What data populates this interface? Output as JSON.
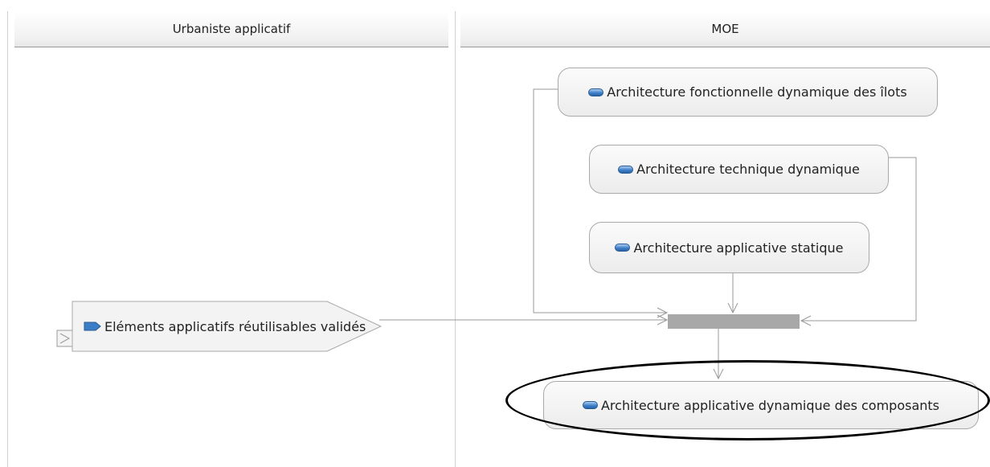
{
  "lanes": [
    {
      "label": "Urbaniste applicatif"
    },
    {
      "label": "MOE"
    }
  ],
  "nodes": {
    "func_dyn": {
      "label": "Architecture fonctionnelle dynamique des îlots",
      "icon": "activity-pill-icon"
    },
    "tech_dyn": {
      "label": "Architecture technique dynamique",
      "icon": "activity-pill-icon"
    },
    "app_stat": {
      "label": "Architecture applicative statique",
      "icon": "activity-pill-icon"
    },
    "reuse": {
      "label": "Eléments applicatifs réutilisables validés",
      "icon": "send-signal-icon"
    },
    "app_dyn": {
      "label": "Architecture applicative dynamique des composants",
      "icon": "activity-pill-icon"
    }
  },
  "colors": {
    "join_bar": "#a8a8a8",
    "icon_blue": "#3b7dc7",
    "highlight": "#000000"
  }
}
